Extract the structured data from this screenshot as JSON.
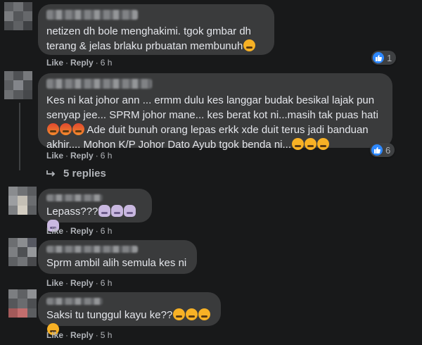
{
  "colors": {
    "background": "#18191a",
    "bubble": "#3a3b3c",
    "text": "#e4e6eb",
    "meta": "#b0b3b8",
    "like_blue": "#2d88ff"
  },
  "comments": [
    {
      "text": "netizen dh bole menghakimi. tgok gmbar dh terang & jelas brlaku prbuatan membunuh",
      "emojis": [
        "sad"
      ],
      "like_label": "Like",
      "reply_label": "Reply",
      "time": "6 h",
      "reaction_icon": "like-icon",
      "reaction_count": "1"
    },
    {
      "text_1": "Kes ni kat johor ann ... ermm dulu kes langgar budak besikal lajak pun senyap jee... SPRM johor mane... kes berat kot ni...masih tak puas hati ",
      "emojis_1": [
        "angry",
        "angry",
        "angry"
      ],
      "text_2": " Ade duit bunuh orang lepas erkk xde duit terus jadi banduan akhir.... Mohon K/P Johor Dato Ayub tgok benda ni...",
      "emojis_2": [
        "sad",
        "sad",
        "sad"
      ],
      "like_label": "Like",
      "reply_label": "Reply",
      "time": "6 h",
      "reaction_icon": "like-icon",
      "reaction_count": "6",
      "replies_label": "5 replies",
      "replies_icon": "reply-arrow-icon"
    },
    {
      "text": "Lepass???",
      "emojis": [
        "person",
        "person",
        "person",
        "person"
      ],
      "like_label": "Like",
      "reply_label": "Reply",
      "time": "6 h"
    },
    {
      "text": "Sprm ambil alih semula kes ni",
      "like_label": "Like",
      "reply_label": "Reply",
      "time": "6 h"
    },
    {
      "text": "Saksi tu tunggul kayu ke??",
      "emojis": [
        "laugh",
        "laugh",
        "laugh",
        "laugh"
      ],
      "like_label": "Like",
      "reply_label": "Reply",
      "time": "5 h"
    }
  ]
}
